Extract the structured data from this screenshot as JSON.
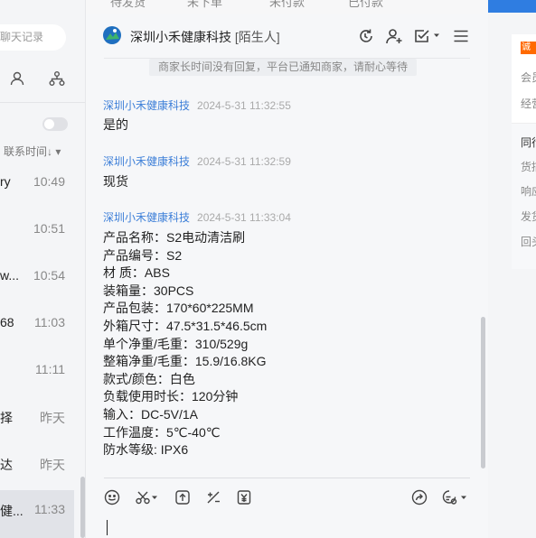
{
  "top_tabs": [
    "待发货",
    "未下单",
    "未付款",
    "已付款"
  ],
  "sidebar": {
    "search_placeholder": "聊天记录",
    "sort_label": "联系时间↓ ▾",
    "contacts": [
      {
        "name": "ry",
        "time": "10:49"
      },
      {
        "name": "",
        "time": "10:51"
      },
      {
        "name": "w...",
        "time": "10:54"
      },
      {
        "name": "68",
        "time": "11:03"
      },
      {
        "name": "",
        "time": "11:11"
      },
      {
        "name": "择",
        "time": "昨天"
      },
      {
        "name": "达",
        "time": "昨天"
      },
      {
        "name": "健...",
        "time": "11:33"
      }
    ]
  },
  "header": {
    "title": "深圳小禾健康科技",
    "tag": "[陌生人]"
  },
  "notice": "商家长时间没有回复，平台已通知商家，请耐心等待",
  "messages": [
    {
      "sender": "深圳小禾健康科技",
      "time": "2024-5-31 11:32:55",
      "lines": [
        "是的"
      ]
    },
    {
      "sender": "深圳小禾健康科技",
      "time": "2024-5-31 11:32:59",
      "lines": [
        "现货"
      ]
    },
    {
      "sender": "深圳小禾健康科技",
      "time": "2024-5-31 11:33:04",
      "lines": [
        "产品名称：S2电动清洁刷",
        "产品编号：S2",
        "材 质：ABS",
        "装箱量：30PCS",
        "产品包装：170*60*225MM",
        "外箱尺寸：47.5*31.5*46.5cm",
        "单个净重/毛重：310/529g",
        "整箱净重/毛重：15.9/16.8KG",
        "款式/颜色：白色",
        "负载使用时长：120分钟",
        "输入：DC-5V/1A",
        "工作温度：5℃-40℃",
        "防水等级: IPX6"
      ]
    }
  ],
  "right_panel": {
    "badge": "诚",
    "items": [
      "会员",
      "经营",
      "同行",
      "货描",
      "响应",
      "发货",
      "回头"
    ]
  },
  "colors": {
    "accent": "#3d7fd8",
    "badge": "#ff6a00",
    "top_bar": "#2f7de1"
  }
}
